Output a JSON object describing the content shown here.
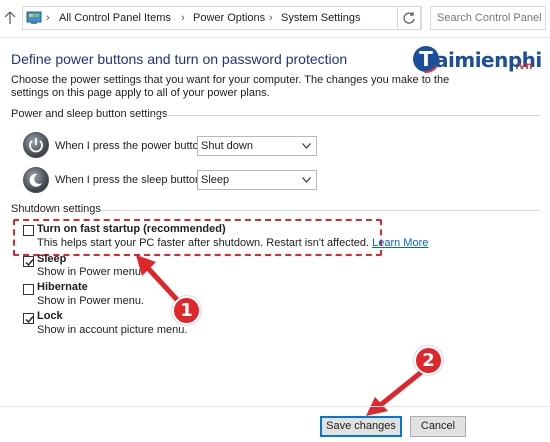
{
  "address_bar": {
    "crumbs": [
      "All Control Panel Items",
      "Power Options",
      "System Settings"
    ],
    "separator": "›",
    "search_placeholder": "Search Control Panel"
  },
  "logo": {
    "text": "aimienphi",
    "tld": ".vn",
    "initial": "T"
  },
  "page": {
    "title": "Define power buttons and turn on password protection",
    "intro": "Choose the power settings that you want for your computer. The changes you make to the settings on this page apply to all of your power plans."
  },
  "power_section": {
    "label": "Power and sleep button settings",
    "rows": [
      {
        "label": "When I press the power button:",
        "value": "Shut down",
        "icon": "power-button-icon"
      },
      {
        "label": "When I press the sleep button:",
        "value": "Sleep",
        "icon": "sleep-button-icon"
      }
    ]
  },
  "shutdown_section": {
    "label": "Shutdown settings",
    "options": [
      {
        "title": "Turn on fast startup (recommended)",
        "desc": "This helps start your PC faster after shutdown. Restart isn't affected.",
        "link": "Learn More",
        "checked": false
      },
      {
        "title": "Sleep",
        "desc": "Show in Power menu.",
        "checked": true
      },
      {
        "title": "Hibernate",
        "desc": "Show in Power menu.",
        "checked": false
      },
      {
        "title": "Lock",
        "desc": "Show in account picture menu.",
        "checked": true
      }
    ]
  },
  "annotations": {
    "badge1": "1",
    "badge2": "2"
  },
  "buttons": {
    "save": "Save changes",
    "cancel": "Cancel"
  },
  "colors": {
    "accent_red": "#e0252b",
    "title_blue": "#1e3287",
    "link_blue": "#0066cc",
    "logo_blue": "#1a4f9c"
  }
}
